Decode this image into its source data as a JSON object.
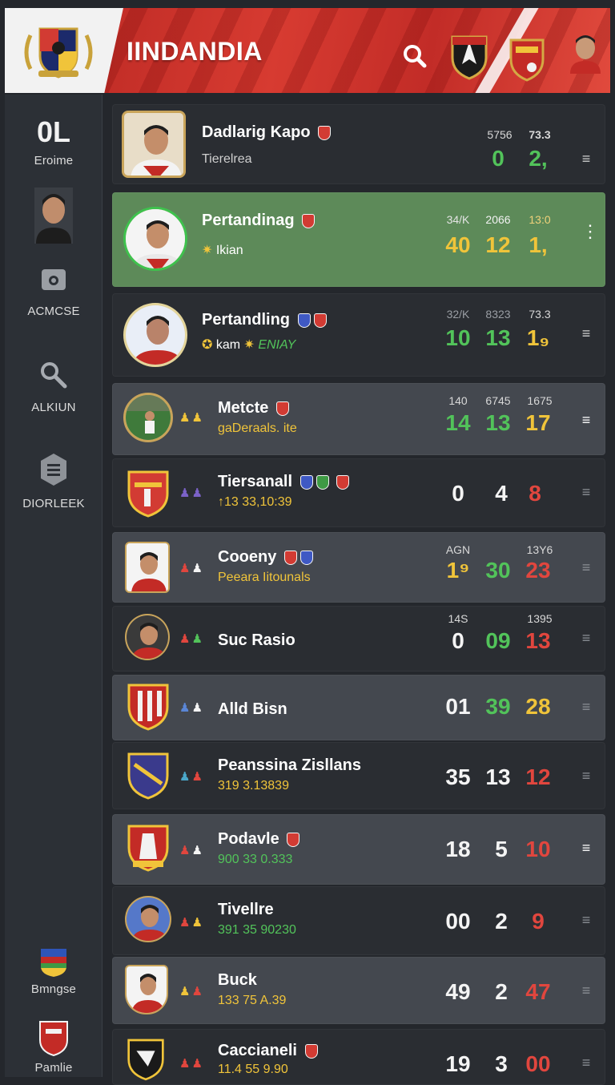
{
  "header": {
    "title": "IINDANDIA",
    "accent": "#c8302a"
  },
  "sidebar": {
    "top_big": "0L",
    "items": [
      {
        "label": "Eroime"
      },
      {
        "label": "ACMCSE",
        "icon": "camera-icon"
      },
      {
        "label": "ALKIUN",
        "icon": "search-icon"
      },
      {
        "label": "DIORLEEK",
        "icon": "list-icon"
      },
      {
        "label": "Bmngse",
        "icon": "flag-icon"
      },
      {
        "label": "Pamlie",
        "icon": "crest-icon"
      }
    ]
  },
  "rows": [
    {
      "name": "Dadlarig Kapo",
      "sub": "Tierelrea",
      "h1": "5756",
      "h2": "73.3",
      "s1": "0",
      "s2": "2,"
    },
    {
      "name": "Pertandinag",
      "sub": "Ikian",
      "h1": "34/K",
      "h2": "2066",
      "h3": "13:0",
      "s1": "40",
      "s2": "12",
      "s3": "1,"
    },
    {
      "name": "Pertandling",
      "sub": "kam",
      "sub2": "ENIAY",
      "h1": "32/K",
      "h2": "8323",
      "h3": "73.3",
      "s1": "10",
      "s2": "13",
      "s3": "1₉"
    },
    {
      "name": "Metcte",
      "sub": "gaDeraals. ite",
      "h1": "140",
      "h2": "6745",
      "h3": "1675",
      "s1": "14",
      "s2": "13",
      "s3": "17"
    },
    {
      "name": "Tiersanall",
      "sub": "↑13 33,10:39",
      "s1": "0",
      "s2": "4",
      "s3": "8"
    },
    {
      "name": "Cooeny",
      "sub": "Peeara Iitounals",
      "h1": "AGN",
      "h3": "13Y6",
      "s1": "1⁹",
      "s2": "30",
      "s3": "23"
    },
    {
      "name": "Suc Rasio",
      "h1": "14S",
      "h3": "1395",
      "s1": "0",
      "s2": "09",
      "s3": "13"
    },
    {
      "name": "Alld Bisn",
      "s1": "01",
      "s2": "39",
      "s3": "28"
    },
    {
      "name": "Peanssina Zisllans",
      "sub": "319 3.13839",
      "s1": "35",
      "s2": "13",
      "s3": "12"
    },
    {
      "name": "Podavle",
      "sub": "900 33 0.333",
      "s1": "18",
      "s2": "5",
      "s3": "10"
    },
    {
      "name": "Tivellre",
      "sub": "391 35 90230",
      "s1": "00",
      "s2": "2",
      "s3": "9"
    },
    {
      "name": "Buck",
      "sub": "133 75 A.39",
      "s1": "49",
      "s2": "2",
      "s3": "47"
    },
    {
      "name": "Caccianeli",
      "sub": "11.4 55 9.90",
      "s1": "19",
      "s2": "3",
      "s3": "00"
    }
  ]
}
